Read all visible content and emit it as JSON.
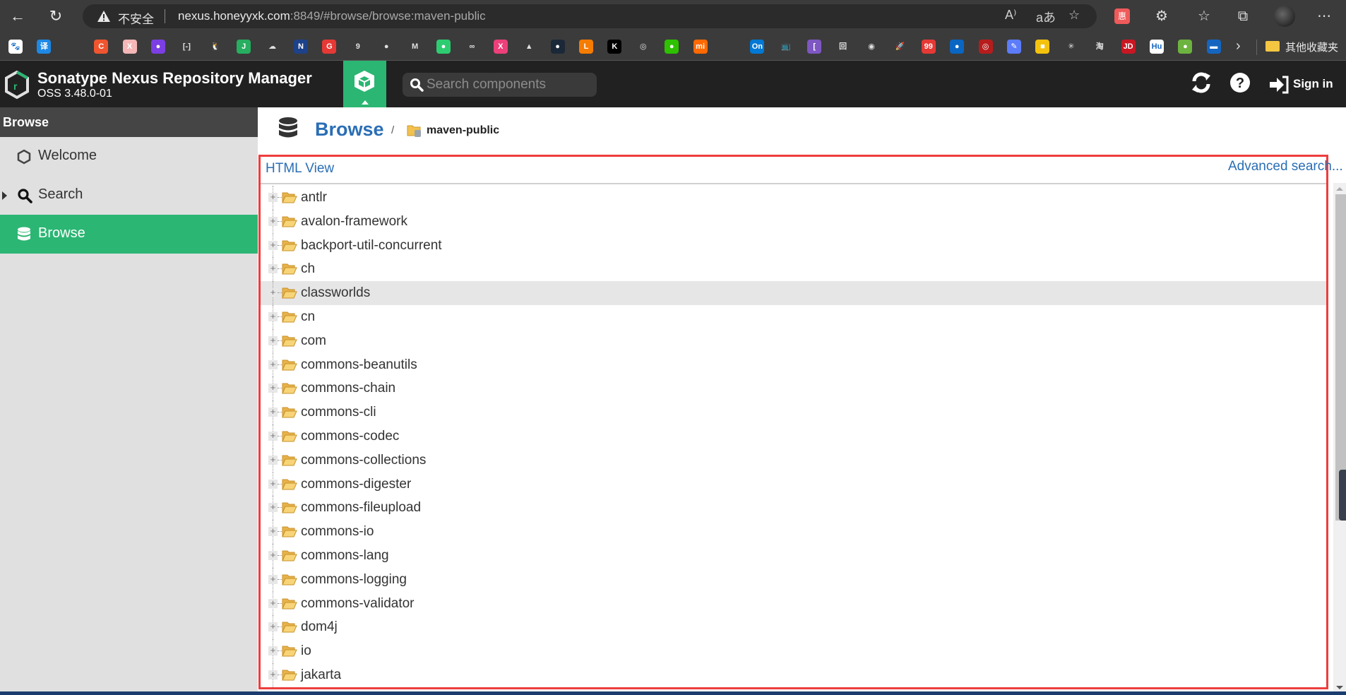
{
  "browser": {
    "security_label": "不安全",
    "url_host": "nexus.honeyyxk.com",
    "url_rest": ":8849/#browse/browse:maven-public",
    "ext_badge": "惠",
    "bookmarks_folder": "其他收藏夹",
    "bookmarks": [
      {
        "icon": "baidu-paw-icon",
        "glyph": "🐾",
        "color": "#ffffff"
      },
      {
        "icon": "translate-icon",
        "glyph": "译",
        "color": "#1e88e5"
      },
      {
        "icon": "page-icon",
        "glyph": "",
        "color": "#3b3b3b"
      },
      {
        "icon": "csdn-icon",
        "glyph": "C",
        "color": "#f0552f"
      },
      {
        "icon": "x-icon",
        "glyph": "X",
        "color": "#f5b7b7"
      },
      {
        "icon": "circle-purple-icon",
        "glyph": "●",
        "color": "#7b3fe4"
      },
      {
        "icon": "bracket-icon",
        "glyph": "[-]",
        "color": "#3b3b3b"
      },
      {
        "icon": "qq-icon",
        "glyph": "🐧",
        "color": "#3b3b3b"
      },
      {
        "icon": "json-icon",
        "glyph": "J",
        "color": "#27ae60"
      },
      {
        "icon": "cloud-icon",
        "glyph": "☁",
        "color": "#3b3b3b"
      },
      {
        "icon": "nba-icon",
        "glyph": "N",
        "color": "#1d428a"
      },
      {
        "icon": "g-icon",
        "glyph": "G",
        "color": "#e53935"
      },
      {
        "icon": "script-icon",
        "glyph": "9",
        "color": "#3b3b3b"
      },
      {
        "icon": "github-icon",
        "glyph": "●",
        "color": "#3b3b3b"
      },
      {
        "icon": "m-icon",
        "glyph": "M",
        "color": "#3b3b3b"
      },
      {
        "icon": "leaf-icon",
        "glyph": "●",
        "color": "#2ecc71"
      },
      {
        "icon": "infinity-icon",
        "glyph": "∞",
        "color": "#3b3b3b"
      },
      {
        "icon": "x-pink-icon",
        "glyph": "X",
        "color": "#ec407a"
      },
      {
        "icon": "chart-icon",
        "glyph": "▲",
        "color": "#3b3b3b"
      },
      {
        "icon": "steam-icon",
        "glyph": "●",
        "color": "#1b2838"
      },
      {
        "icon": "orange-l-icon",
        "glyph": "L",
        "color": "#f57c00"
      },
      {
        "icon": "k-icon",
        "glyph": "K",
        "color": "#000000"
      },
      {
        "icon": "spiral-icon",
        "glyph": "◎",
        "color": "#3b3b3b"
      },
      {
        "icon": "wechat-icon",
        "glyph": "●",
        "color": "#2dc100"
      },
      {
        "icon": "xiaomi-icon",
        "glyph": "mi",
        "color": "#ff6900"
      },
      {
        "icon": "page-icon",
        "glyph": "",
        "color": "#3b3b3b"
      },
      {
        "icon": "onenote-icon",
        "glyph": "On",
        "color": "#0078d4"
      },
      {
        "icon": "bilibili-icon",
        "glyph": "📺",
        "color": "#3b3b3b"
      },
      {
        "icon": "bracket-purple-icon",
        "glyph": "[",
        "color": "#7e57c2"
      },
      {
        "icon": "maze-icon",
        "glyph": "回",
        "color": "#3b3b3b"
      },
      {
        "icon": "green-ring-icon",
        "glyph": "◉",
        "color": "#3b3b3b"
      },
      {
        "icon": "rocket-icon",
        "glyph": "🚀",
        "color": "#3b3b3b"
      },
      {
        "icon": "99-icon",
        "glyph": "99",
        "color": "#e53935"
      },
      {
        "icon": "edge-blue-icon",
        "glyph": "●",
        "color": "#0a66c2"
      },
      {
        "icon": "railway-icon",
        "glyph": "◎",
        "color": "#b71c1c"
      },
      {
        "icon": "pen-icon",
        "glyph": "✎",
        "color": "#5c7cfa"
      },
      {
        "icon": "yellow-box-icon",
        "glyph": "■",
        "color": "#f4c20d"
      },
      {
        "icon": "sparkle-icon",
        "glyph": "✳",
        "color": "#3b3b3b"
      },
      {
        "icon": "taobao-icon",
        "glyph": "淘",
        "color": "#3b3b3b"
      },
      {
        "icon": "jd-icon",
        "glyph": "JD",
        "color": "#c91623"
      },
      {
        "icon": "hu-icon",
        "glyph": "Hu",
        "color": "#ffffff"
      },
      {
        "icon": "spring-icon",
        "glyph": "●",
        "color": "#6db33f"
      },
      {
        "icon": "blue-banner-icon",
        "glyph": "▬",
        "color": "#1565c0"
      }
    ]
  },
  "header": {
    "title": "Sonatype Nexus Repository Manager",
    "version": "OSS 3.48.0-01",
    "search_placeholder": "Search components",
    "sign_in": "Sign in",
    "accent": "#2bb673"
  },
  "sidebar": {
    "header": "Browse",
    "items": [
      {
        "label": "Welcome",
        "icon": "hexagon-icon"
      },
      {
        "label": "Search",
        "icon": "search-icon"
      },
      {
        "label": "Browse",
        "icon": "database-icon",
        "active": true
      }
    ]
  },
  "breadcrumb": {
    "section": "Browse",
    "separator": "/",
    "repository": "maven-public"
  },
  "panel": {
    "html_view": "HTML View",
    "advanced_search": "Advanced search...",
    "tree": [
      "antlr",
      "avalon-framework",
      "backport-util-concurrent",
      "ch",
      "classworlds",
      "cn",
      "com",
      "commons-beanutils",
      "commons-chain",
      "commons-cli",
      "commons-codec",
      "commons-collections",
      "commons-digester",
      "commons-fileupload",
      "commons-io",
      "commons-lang",
      "commons-logging",
      "commons-validator",
      "dom4j",
      "io",
      "jakarta"
    ],
    "hovered_index": 4
  }
}
